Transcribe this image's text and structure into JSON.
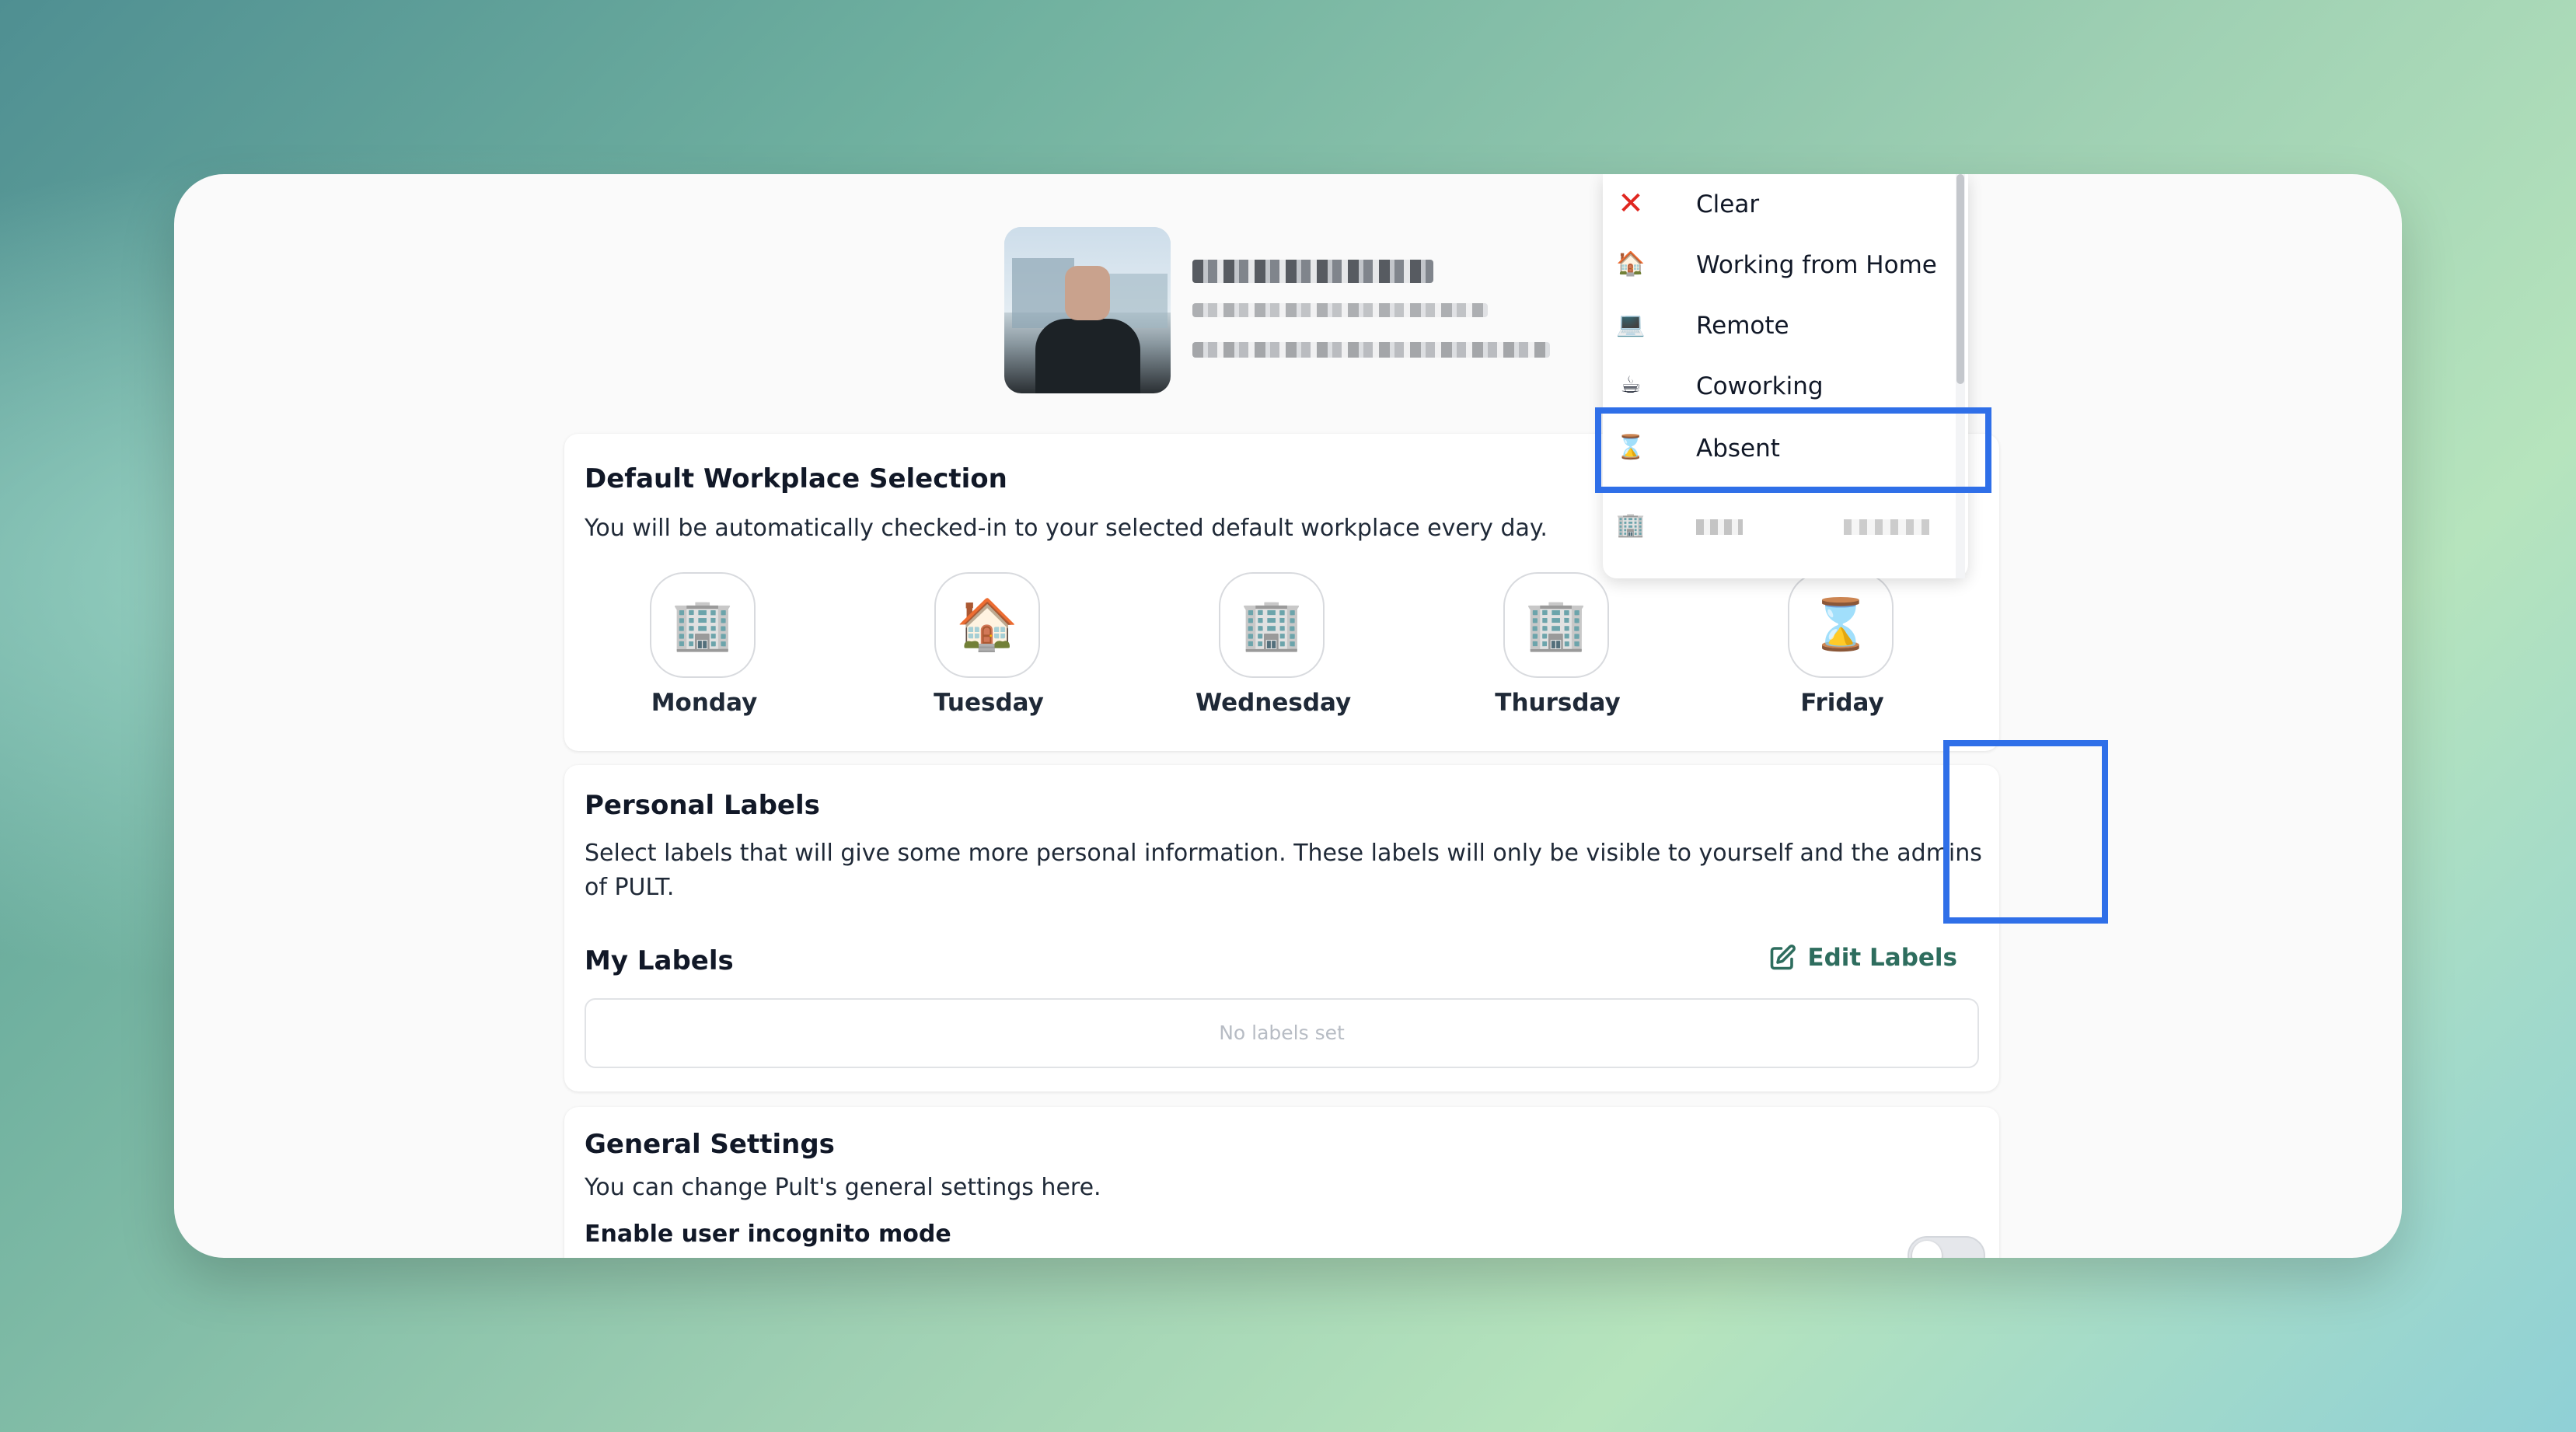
{
  "profile": {
    "avatar_alt": "User photo"
  },
  "workplace": {
    "title": "Default Workplace Selection",
    "description": "You will be automatically checked-in to your selected default workplace every day.",
    "days": [
      {
        "label": "Monday",
        "icon": "🏢",
        "icon_name": "office-building-icon"
      },
      {
        "label": "Tuesday",
        "icon": "🏠",
        "icon_name": "house-icon"
      },
      {
        "label": "Wednesday",
        "icon": "🏢",
        "icon_name": "office-building-icon"
      },
      {
        "label": "Thursday",
        "icon": "🏢",
        "icon_name": "office-building-icon"
      },
      {
        "label": "Friday",
        "icon": "⌛",
        "icon_name": "hourglass-icon"
      }
    ]
  },
  "labels": {
    "title": "Personal Labels",
    "description": "Select labels that will give some more personal information. These labels will only be visible to yourself and the admins of PULT.",
    "my_labels_title": "My Labels",
    "edit_labels": "Edit Labels",
    "empty_state": "No labels set"
  },
  "general": {
    "title": "General Settings",
    "description": "You can change Pult's general settings here.",
    "incognito_label": "Enable user incognito mode",
    "incognito_enabled": false
  },
  "dropdown": {
    "items": [
      {
        "label": "Clear",
        "icon": "✕",
        "icon_name": "clear-x-icon"
      },
      {
        "label": "Working from Home",
        "icon": "🏠",
        "icon_name": "house-icon"
      },
      {
        "label": "Remote",
        "icon": "💻",
        "icon_name": "laptop-icon"
      },
      {
        "label": "Coworking",
        "icon": "☕",
        "icon_name": "coffee-icon"
      },
      {
        "label": "Absent",
        "icon": "⌛",
        "icon_name": "hourglass-icon"
      },
      {
        "label": "",
        "icon": "🏢",
        "icon_name": "office-building-icon"
      }
    ]
  },
  "colors": {
    "accent_highlight": "#2f6fe8",
    "edit_link": "#2e6d5e",
    "clear_red": "#e0261f"
  }
}
